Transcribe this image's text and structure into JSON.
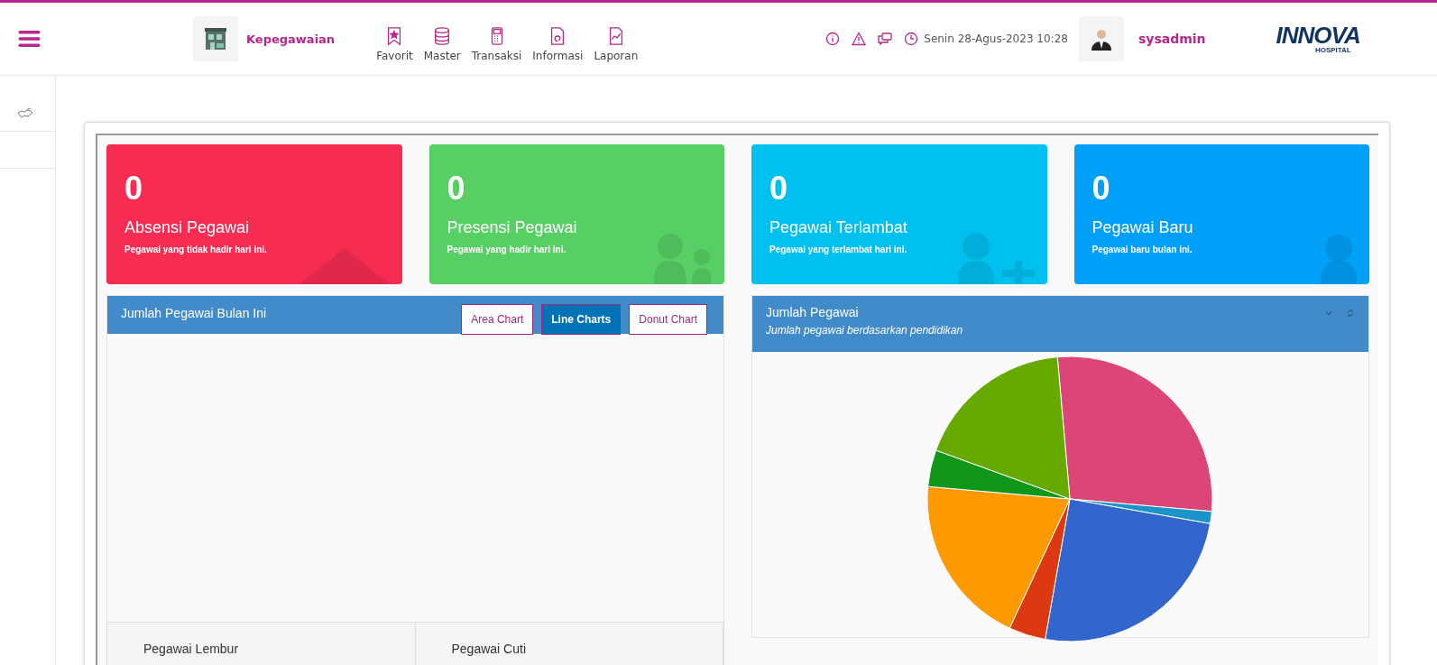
{
  "header": {
    "module": "Kepegawaian",
    "nav": [
      {
        "label": "Favorit",
        "kind": "bookmark"
      },
      {
        "label": "Master",
        "kind": "database"
      },
      {
        "label": "Transaksi",
        "kind": "terminal"
      },
      {
        "label": "Informasi",
        "kind": "document"
      },
      {
        "label": "Laporan",
        "kind": "report"
      }
    ],
    "datetime": "Senin 28-Agus-2023 10:28",
    "user": "sysadmin",
    "logo": "INNOVA",
    "logo_sub": "HOSPITAL"
  },
  "stat_cards": [
    {
      "value": "0",
      "title": "Absensi Pegawai",
      "subtitle": "Pegawai yang tidak hadir hari ini.",
      "color": "#f72c53",
      "kind": "triangle"
    },
    {
      "value": "0",
      "title": "Presensi Pegawai",
      "subtitle": "Pegawai yang hadir hari ini.",
      "color": "#57cf65",
      "kind": "people"
    },
    {
      "value": "0",
      "title": "Pegawai Terlambat",
      "subtitle": "Pegawai yang terlambat hari ini.",
      "color": "#00c0ef",
      "kind": "person-plus"
    },
    {
      "value": "0",
      "title": "Pegawai Baru",
      "subtitle": "Pegawai baru bulan ini.",
      "color": "#00a0f8",
      "kind": "person"
    }
  ],
  "monthly_panel": {
    "title": "Jumlah Pegawai Bulan Ini",
    "tabs": [
      {
        "label": "Area Chart",
        "selected": false
      },
      {
        "label": "Line Charts",
        "selected": true
      },
      {
        "label": "Donut Chart",
        "selected": false
      }
    ]
  },
  "education_panel": {
    "title": "Jumlah Pegawai",
    "subtitle": "Jumlah pegawai berdasarkan pendidikan"
  },
  "bottom_boxes": [
    "Pegawai Lembur",
    "Pegawai Cuti"
  ]
}
